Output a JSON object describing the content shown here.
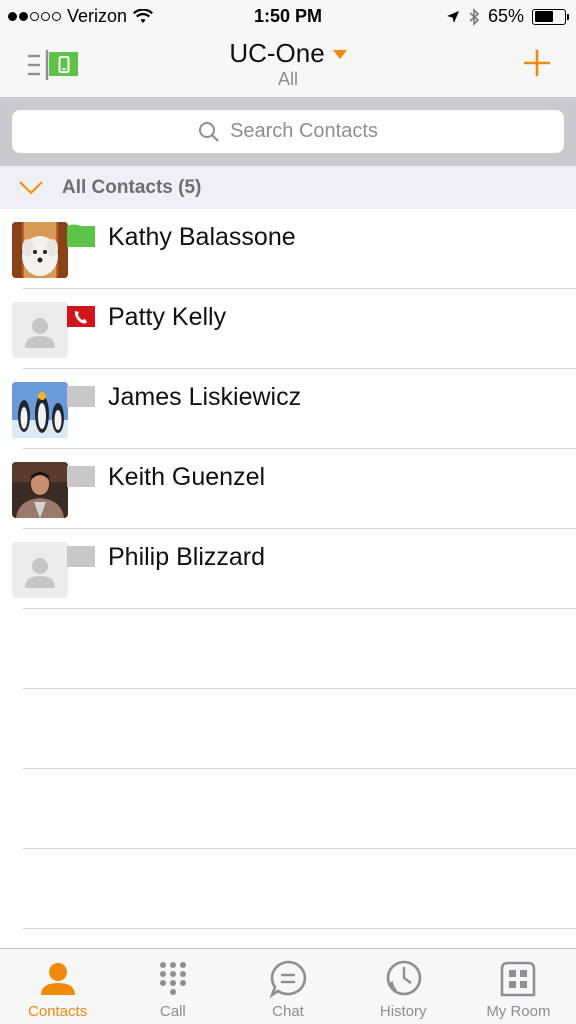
{
  "status_bar": {
    "carrier": "Verizon",
    "time": "1:50 PM",
    "battery_percent": "65%",
    "battery_level": 0.65,
    "signal_bars_filled": 2,
    "signal_bars_total": 5
  },
  "nav": {
    "title": "UC-One",
    "subtitle": "All"
  },
  "search": {
    "placeholder": "Search Contacts"
  },
  "group": {
    "label": "All Contacts (5)"
  },
  "contacts": [
    {
      "name": "Kathy Balassone",
      "presence": "available",
      "avatar": "dog-photo"
    },
    {
      "name": "Patty Kelly",
      "presence": "on-call",
      "avatar": "default-person"
    },
    {
      "name": "James Liskiewicz",
      "presence": "offline",
      "avatar": "penguins-photo"
    },
    {
      "name": "Keith Guenzel",
      "presence": "offline",
      "avatar": "man-photo"
    },
    {
      "name": "Philip Blizzard",
      "presence": "offline",
      "avatar": "default-person"
    }
  ],
  "tabs": [
    {
      "label": "Contacts",
      "icon": "person-icon",
      "active": true
    },
    {
      "label": "Call",
      "icon": "dialpad-icon",
      "active": false
    },
    {
      "label": "Chat",
      "icon": "chat-bubble-icon",
      "active": false
    },
    {
      "label": "History",
      "icon": "history-clock-icon",
      "active": false
    },
    {
      "label": "My Room",
      "icon": "my-room-icon",
      "active": false
    }
  ],
  "colors": {
    "accent": "#f08a0c",
    "available_green": "#5cc24a",
    "busy_red": "#d0161b",
    "offline_gray": "#c8c8c8"
  }
}
